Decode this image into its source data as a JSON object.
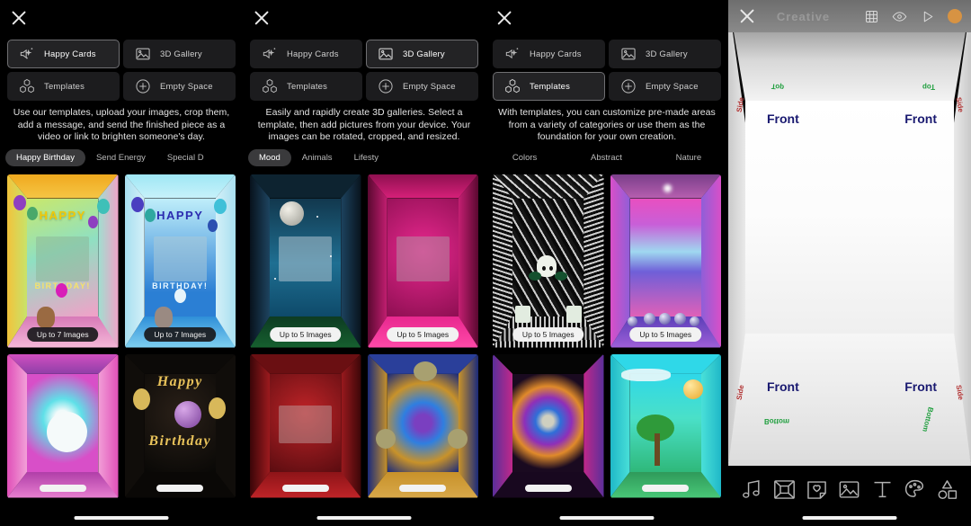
{
  "modes": {
    "happy_cards": "Happy Cards",
    "gallery_3d": "3D Gallery",
    "templates": "Templates",
    "empty_space": "Empty Space"
  },
  "panels": [
    {
      "active_mode": "Happy Cards",
      "description": "Use our templates, upload your images, crop them, add a message, and send the finished piece as a video or link to brighten someone's day.",
      "categories": [
        {
          "label": "Happy Birthday",
          "active": true
        },
        {
          "label": "Send Energy",
          "active": false
        },
        {
          "label": "Special D",
          "active": false
        }
      ],
      "thumbnails": [
        {
          "badge": "Up to 7 Images",
          "badge_style": "dark"
        },
        {
          "badge": "Up to 7 Images",
          "badge_style": "dark"
        },
        {
          "badge": "",
          "badge_style": "blank"
        },
        {
          "badge": "",
          "badge_style": "blank"
        }
      ]
    },
    {
      "active_mode": "3D Gallery",
      "description": "Easily and rapidly create 3D galleries. Select a template, then add pictures from your device. Your images can be rotated, cropped, and resized.",
      "categories": [
        {
          "label": "Mood",
          "active": true
        },
        {
          "label": "Animals",
          "active": false
        },
        {
          "label": "Lifesty",
          "active": false
        }
      ],
      "thumbnails": [
        {
          "badge": "Up to 5 Images",
          "badge_style": "light"
        },
        {
          "badge": "Up to 5 Images",
          "badge_style": "light"
        },
        {
          "badge": "",
          "badge_style": "blank"
        },
        {
          "badge": "",
          "badge_style": "blank"
        }
      ]
    },
    {
      "active_mode": "Templates",
      "description": "With templates, you can customize pre-made areas from a variety of categories or use them as the foundation for your own creation.",
      "categories": [
        {
          "label": "Colors",
          "active": false
        },
        {
          "label": "Abstract",
          "active": false
        },
        {
          "label": "Nature",
          "active": false
        }
      ],
      "thumbnails": [
        {
          "badge": "Up to 5 Images",
          "badge_style": "light"
        },
        {
          "badge": "Up to 5 Images",
          "badge_style": "light"
        },
        {
          "badge": "",
          "badge_style": "blank"
        },
        {
          "badge": "",
          "badge_style": "blank"
        }
      ]
    }
  ],
  "card_text": {
    "happy": "HAPPY",
    "birthday": "BIRTHDAY!",
    "happy_script": "Happy",
    "birthday_script": "Birthday"
  },
  "editor": {
    "title": "Creative",
    "room_labels": {
      "front": "Front",
      "top": "Top",
      "bottom": "Bottom",
      "side": "Side"
    },
    "top_icons": [
      "grid-icon",
      "eye-icon",
      "play-icon",
      "color-dot"
    ],
    "toolbar_icons": [
      "music-icon",
      "room-icon",
      "sticker-icon",
      "image-icon",
      "text-icon",
      "palette-icon",
      "shapes-icon"
    ],
    "colors": {
      "front_label": "#191970",
      "top_label": "#1d9e3c",
      "side_label": "#b03030",
      "accent_dot": "#d79343"
    }
  }
}
